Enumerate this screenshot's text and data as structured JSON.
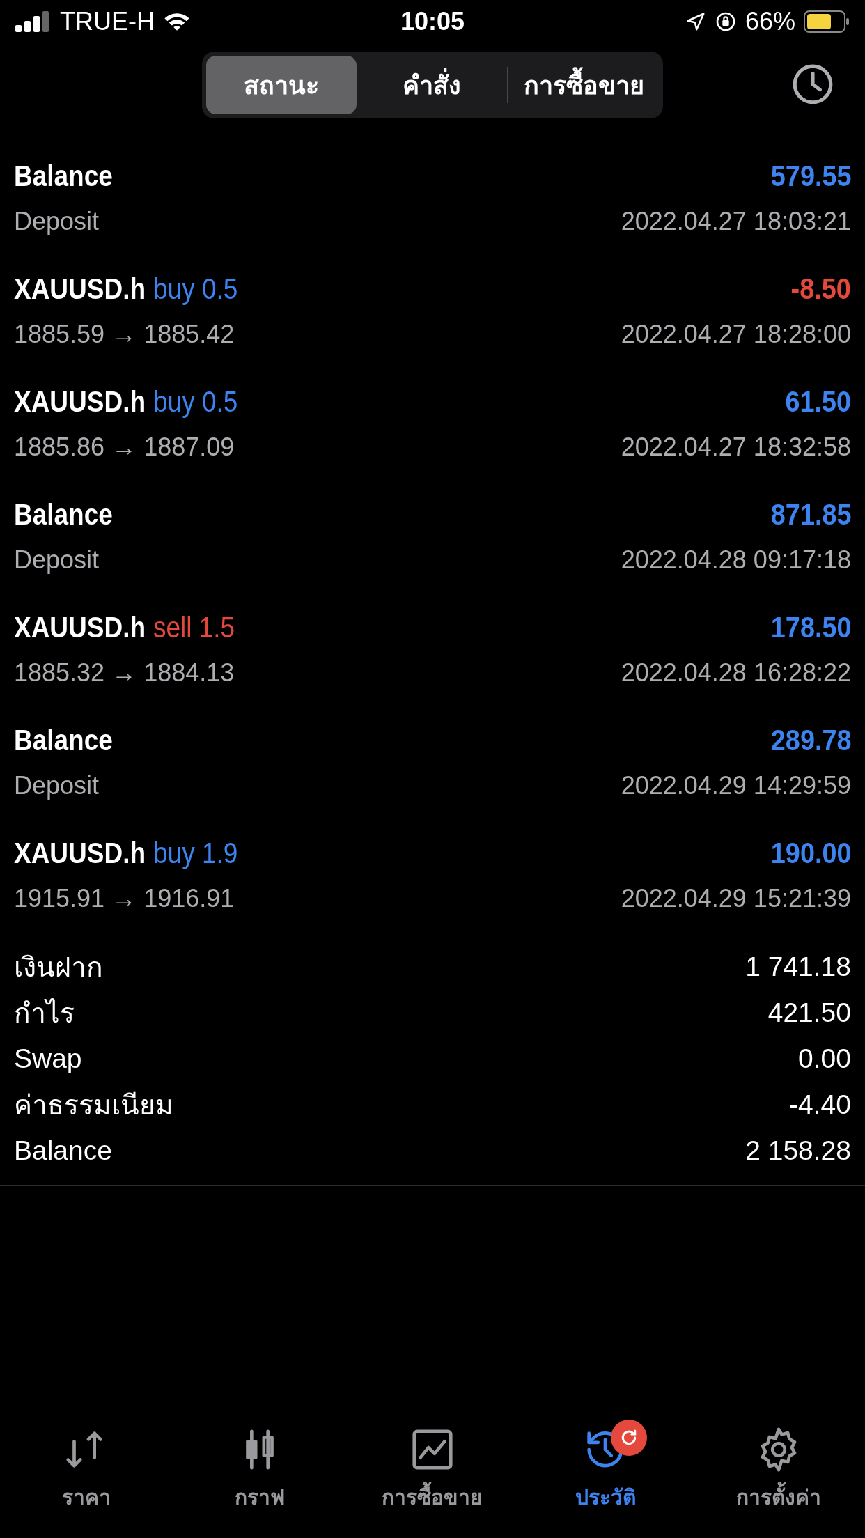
{
  "status_bar": {
    "carrier": "TRUE-H",
    "time": "10:05",
    "battery": "66%"
  },
  "tabs": [
    {
      "label": "สถานะ",
      "selected": true
    },
    {
      "label": "คำสั่ง",
      "selected": false
    },
    {
      "label": "การซื้อขาย",
      "selected": false
    }
  ],
  "deals": [
    {
      "kind": "balance",
      "title": "Balance",
      "amount": "579.55",
      "loss": false,
      "detail": "Deposit",
      "time": "2022.04.27 18:03:21"
    },
    {
      "kind": "trade",
      "title": "XAUUSD.h",
      "side": "buy",
      "volume": "0.5",
      "amount": "-8.50",
      "loss": true,
      "detail": "1885.59 → 1885.42",
      "time": "2022.04.27 18:28:00"
    },
    {
      "kind": "trade",
      "title": "XAUUSD.h",
      "side": "buy",
      "volume": "0.5",
      "amount": "61.50",
      "loss": false,
      "detail": "1885.86 → 1887.09",
      "time": "2022.04.27 18:32:58"
    },
    {
      "kind": "balance",
      "title": "Balance",
      "amount": "871.85",
      "loss": false,
      "detail": "Deposit",
      "time": "2022.04.28 09:17:18"
    },
    {
      "kind": "trade",
      "title": "XAUUSD.h",
      "side": "sell",
      "volume": "1.5",
      "amount": "178.50",
      "loss": false,
      "detail": "1885.32 → 1884.13",
      "time": "2022.04.28 16:28:22"
    },
    {
      "kind": "balance",
      "title": "Balance",
      "amount": "289.78",
      "loss": false,
      "detail": "Deposit",
      "time": "2022.04.29 14:29:59"
    },
    {
      "kind": "trade",
      "title": "XAUUSD.h",
      "side": "buy",
      "volume": "1.9",
      "amount": "190.00",
      "loss": false,
      "detail": "1915.91 → 1916.91",
      "time": "2022.04.29 15:21:39"
    }
  ],
  "summary": [
    {
      "label": "เงินฝาก",
      "value": "1 741.18"
    },
    {
      "label": "กำไร",
      "value": "421.50"
    },
    {
      "label": "Swap",
      "value": "0.00"
    },
    {
      "label": "ค่าธรรมเนียม",
      "value": "-4.40"
    },
    {
      "label": "Balance",
      "value": "2 158.28"
    }
  ],
  "bottom_tabs": [
    {
      "kind": "quotes",
      "label": "ราคา",
      "selected": false
    },
    {
      "kind": "chart",
      "label": "กราฟ",
      "selected": false
    },
    {
      "kind": "trade",
      "label": "การซื้อขาย",
      "selected": false
    },
    {
      "kind": "history",
      "label": "ประวัติ",
      "selected": true
    },
    {
      "kind": "settings",
      "label": "การตั้งค่า",
      "selected": false
    }
  ]
}
